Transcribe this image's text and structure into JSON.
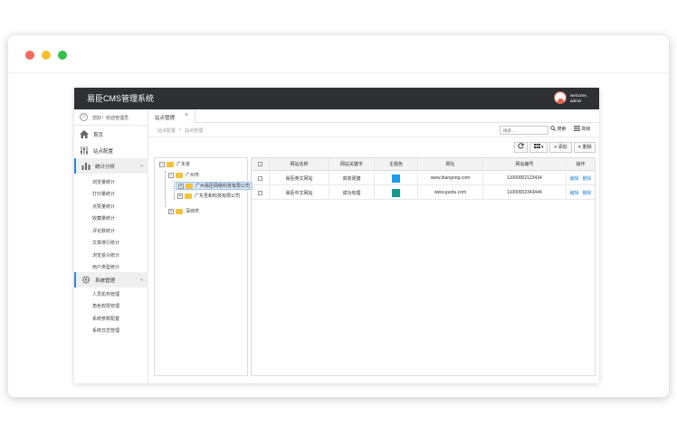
{
  "window": {
    "title": "易臣CMS管理系统"
  },
  "user": {
    "line1": "welcome,",
    "line2": "admin"
  },
  "sidebar": {
    "home_label": "您好！欢迎管理员",
    "items": [
      {
        "label": "首页",
        "icon": "home-icon"
      },
      {
        "label": "站点配置",
        "icon": "sliders-icon"
      }
    ],
    "groups": [
      {
        "label": "统计分析",
        "icon": "chart-icon",
        "children": [
          "浏览量统计",
          "打印量统计",
          "点赞量统计",
          "收藏量统计",
          "评论数统计",
          "文章排行统计",
          "浏览受众统计",
          "用户类型统计"
        ]
      },
      {
        "label": "系统管理",
        "icon": "gear-icon",
        "children": [
          "人员机构管理",
          "角色权限管理",
          "系统参数配置",
          "系统日志管理"
        ]
      }
    ]
  },
  "tabs": [
    {
      "label": "站点管理",
      "close": "×"
    }
  ],
  "breadcrumb": {
    "first": "站点配置",
    "separator": ">",
    "second": "站点管理"
  },
  "search": {
    "placeholder": "搜索...",
    "search_label": "搜索",
    "advanced_label": "高级"
  },
  "toolbar": {
    "refresh_icon": "refresh-icon",
    "columns_icon": "columns-icon",
    "add_label": "添加",
    "delete_label": "删除"
  },
  "tree": {
    "root": "广东省",
    "child1": "广州市",
    "grandchild1": "广州易臣网络科技有限公司",
    "grandchild2": "广东圣和科技有限公司",
    "child2": "深圳市"
  },
  "table": {
    "columns": [
      "网站名称",
      "网站关键字",
      "主题色",
      "网址",
      "网站编号",
      "操作"
    ],
    "rows": [
      {
        "name": "易臣英文网站",
        "keyword": "高效便捷",
        "color": "#1e9bea",
        "url": "www.ibangong.com",
        "code": "11000002123434",
        "edit": "编辑",
        "del": "删除"
      },
      {
        "name": "易臣中文网站",
        "keyword": "成功有理",
        "color": "#179a8c",
        "url": "www.guotu.com",
        "code": "11000002343444",
        "edit": "编辑",
        "del": "删除"
      }
    ]
  }
}
